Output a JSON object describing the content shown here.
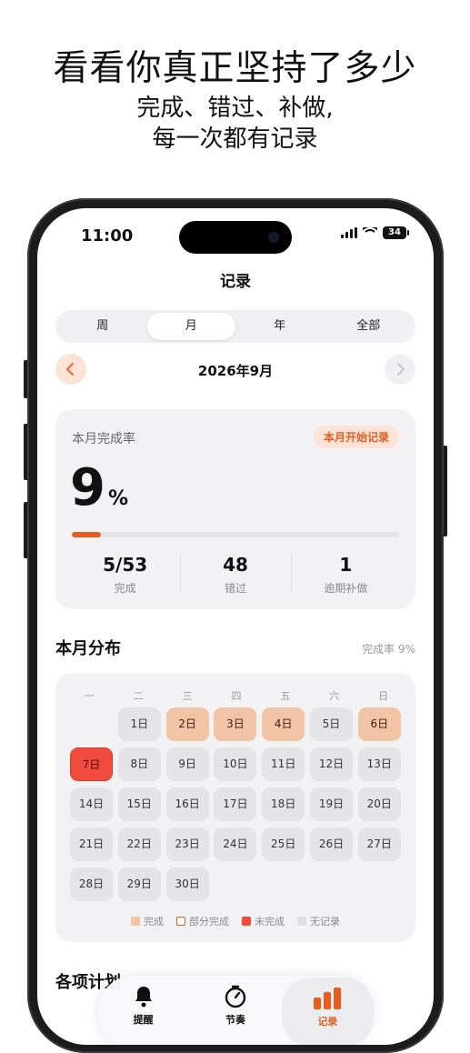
{
  "promo": {
    "headline": "看看你真正坚持了多少",
    "sub1": "完成、错过、补做,",
    "sub2": "每一次都有记录"
  },
  "status_bar": {
    "time": "11:00",
    "battery": "34"
  },
  "nav": {
    "title": "记录"
  },
  "segments": [
    "周",
    "月",
    "年",
    "全部"
  ],
  "active_segment": "月",
  "period": {
    "label": "2026年9月",
    "prev_icon": "chevron-left-icon",
    "next_icon": "chevron-right-icon"
  },
  "summary": {
    "label": "本月完成率",
    "tag": "本月开始记录",
    "rate": "9",
    "unit": "%",
    "progress": 0.09,
    "stats": [
      {
        "value": "5/53",
        "label": "完成"
      },
      {
        "value": "48",
        "label": "错过"
      },
      {
        "value": "1",
        "label": "逾期补做"
      }
    ]
  },
  "distribution": {
    "title": "本月分布",
    "rate_text": "完成率 9%",
    "weekdays": [
      "一",
      "二",
      "三",
      "四",
      "五",
      "六",
      "日"
    ],
    "start_offset": 1,
    "days": [
      {
        "label": "1日",
        "status": "none"
      },
      {
        "label": "2日",
        "status": "done"
      },
      {
        "label": "3日",
        "status": "done"
      },
      {
        "label": "4日",
        "status": "done"
      },
      {
        "label": "5日",
        "status": "none"
      },
      {
        "label": "6日",
        "status": "done"
      },
      {
        "label": "7日",
        "status": "missed"
      },
      {
        "label": "8日",
        "status": "none"
      },
      {
        "label": "9日",
        "status": "none"
      },
      {
        "label": "10日",
        "status": "none"
      },
      {
        "label": "11日",
        "status": "none"
      },
      {
        "label": "12日",
        "status": "none"
      },
      {
        "label": "13日",
        "status": "none"
      },
      {
        "label": "14日",
        "status": "none"
      },
      {
        "label": "15日",
        "status": "none"
      },
      {
        "label": "16日",
        "status": "none"
      },
      {
        "label": "17日",
        "status": "none"
      },
      {
        "label": "18日",
        "status": "none"
      },
      {
        "label": "19日",
        "status": "none"
      },
      {
        "label": "20日",
        "status": "none"
      },
      {
        "label": "21日",
        "status": "none"
      },
      {
        "label": "22日",
        "status": "none"
      },
      {
        "label": "23日",
        "status": "none"
      },
      {
        "label": "24日",
        "status": "none"
      },
      {
        "label": "25日",
        "status": "none"
      },
      {
        "label": "26日",
        "status": "none"
      },
      {
        "label": "27日",
        "status": "none"
      },
      {
        "label": "28日",
        "status": "none"
      },
      {
        "label": "29日",
        "status": "none"
      },
      {
        "label": "30日",
        "status": "none"
      }
    ],
    "legend": [
      {
        "key": "done",
        "label": "完成"
      },
      {
        "key": "partial",
        "label": "部分完成"
      },
      {
        "key": "missed",
        "label": "未完成"
      },
      {
        "key": "none",
        "label": "无记录"
      }
    ]
  },
  "plans": {
    "title": "各项计划"
  },
  "tabbar": [
    {
      "label": "提醒",
      "icon": "bell-icon"
    },
    {
      "label": "节奏",
      "icon": "timer-icon"
    },
    {
      "label": "记录",
      "icon": "bar-chart-icon"
    }
  ],
  "active_tab": "记录",
  "colors": {
    "accent": "#e35e1f",
    "done": "#f3c3a6",
    "missed": "#f04b3c",
    "none": "#e4e4e8"
  }
}
